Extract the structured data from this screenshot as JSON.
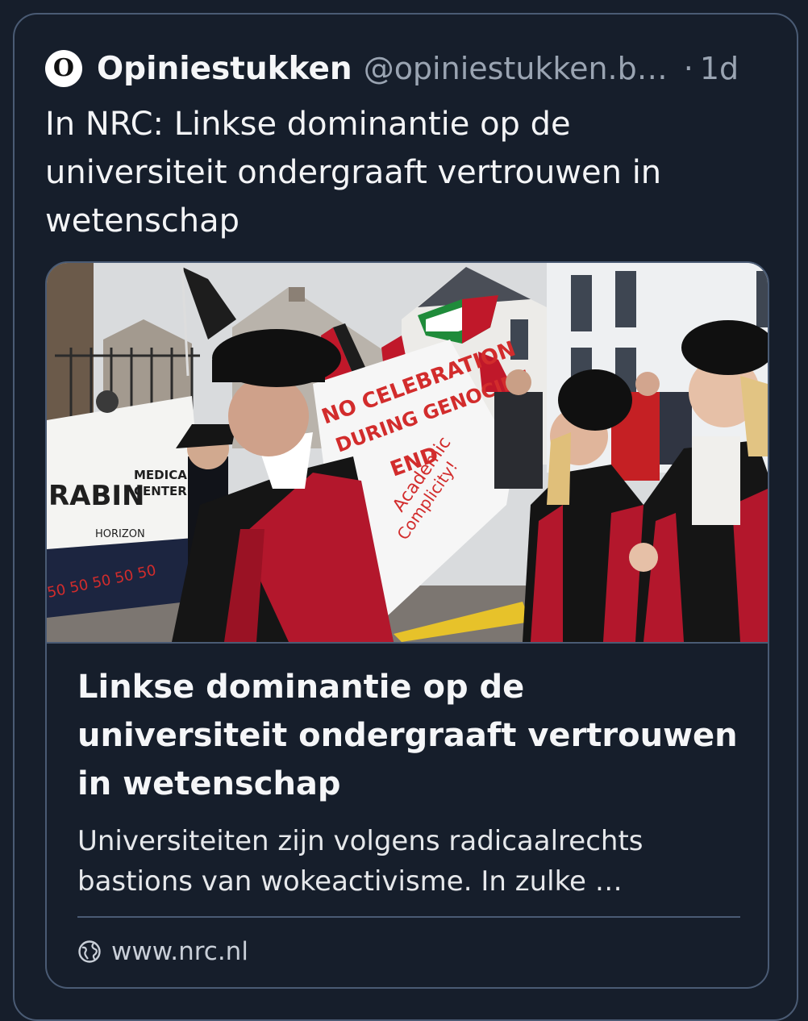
{
  "post": {
    "author_display_name": "Opiniestukken",
    "author_handle": "@opiniestukken.b…",
    "avatar_letter": "O",
    "separator": "·",
    "timestamp": "1d",
    "text": "In NRC: Linkse dominantie op de universiteit ondergraaft vertrouwen in wetenschap"
  },
  "link_card": {
    "title": "Linkse dominantie op de universiteit ondergraaft vertrouwen in wetenschap",
    "description": "Universiteiten zijn volgens radicaalrechts bastions van wokeactivisme. In zulke …",
    "domain": "www.nrc.nl",
    "domain_icon": "globe-icon",
    "image": {
      "banner_left_lines": [
        "RABIN",
        "MEDICAL",
        "CENTER",
        "HORIZON",
        "50 50 50 50 50"
      ],
      "banner_right_lines": [
        "NO CELEBRATION",
        "DURING GENOCIDE",
        "END",
        "Academic",
        "Complicity!"
      ]
    }
  },
  "colors": {
    "background": "#161e2b",
    "border": "#4a5b74",
    "secondary_text": "#9aa4b2",
    "robe_red": "#b3172c",
    "banner_red": "#d22c2c"
  }
}
